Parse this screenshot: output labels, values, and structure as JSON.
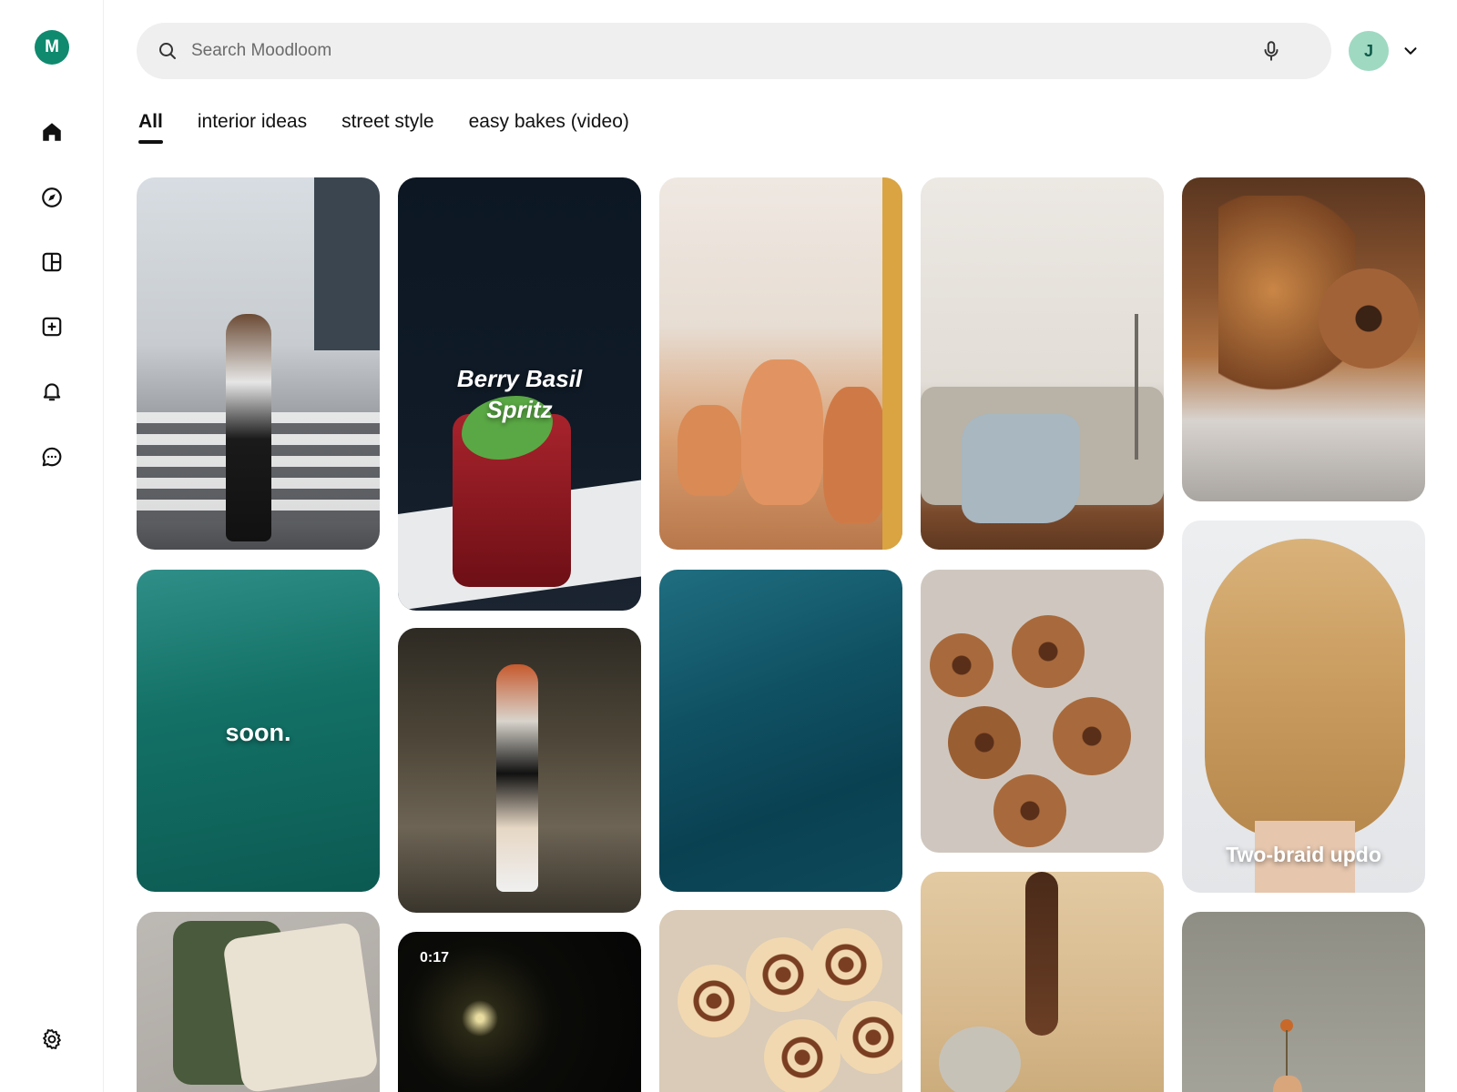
{
  "app": {
    "logo_letter": "M"
  },
  "sidebar": {
    "items": [
      {
        "name": "home",
        "icon": "home-icon"
      },
      {
        "name": "explore",
        "icon": "compass-icon"
      },
      {
        "name": "boards",
        "icon": "layout-icon"
      },
      {
        "name": "create",
        "icon": "plus-square-icon"
      },
      {
        "name": "notifications",
        "icon": "bell-icon"
      },
      {
        "name": "messages",
        "icon": "chat-icon"
      }
    ],
    "settings_icon": "gear-icon"
  },
  "header": {
    "search_placeholder": "Search Moodloom",
    "search_value": "",
    "avatar_letter": "J"
  },
  "tabs": [
    {
      "label": "All",
      "active": true
    },
    {
      "label": "interior ideas",
      "active": false
    },
    {
      "label": "street style",
      "active": false
    },
    {
      "label": "easy bakes (video)",
      "active": false
    }
  ],
  "pins": [
    {
      "id": "crosswalk",
      "overlay": ""
    },
    {
      "id": "spritz",
      "overlay_line1": "Berry Basil",
      "overlay_line2": "Spritz"
    },
    {
      "id": "vases",
      "overlay": ""
    },
    {
      "id": "sofa",
      "overlay": ""
    },
    {
      "id": "dried-flowers",
      "overlay": ""
    },
    {
      "id": "sea-soon",
      "overlay": "soon."
    },
    {
      "id": "redhead-street",
      "overlay": ""
    },
    {
      "id": "deep-water",
      "overlay": ""
    },
    {
      "id": "cinnamon-buns",
      "overlay": ""
    },
    {
      "id": "braids",
      "overlay": "Two-braid updo"
    },
    {
      "id": "pillow",
      "overlay": ""
    },
    {
      "id": "night-video",
      "duration": "0:17"
    },
    {
      "id": "rolls-tray",
      "overlay": ""
    },
    {
      "id": "knitter",
      "overlay": ""
    },
    {
      "id": "vase-flower",
      "overlay": ""
    }
  ],
  "colors": {
    "brand": "#0f8a6e",
    "avatar_bg": "#9fd9c2",
    "search_bg": "#efefef"
  }
}
